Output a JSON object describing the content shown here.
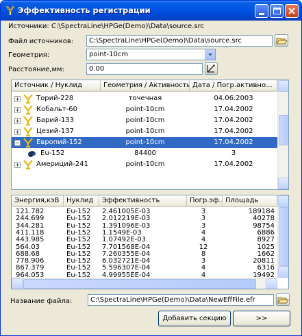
{
  "window": {
    "title": "Эффективность регистрации"
  },
  "sources_label": "Источники: C:\\SpectraLine\\HPGe(Demo)\\Data\\source.src",
  "form": {
    "file_label": "Файл источников:",
    "file_value": "C:\\SpectraLine\\HPGe(Demo)\\Data\\source.src",
    "geometry_label": "Геометрия:",
    "geometry_value": "point-10cm",
    "distance_label": "Расстояние,мм:",
    "distance_value": "0.00"
  },
  "tree": {
    "headers": [
      "Источник / Нуклид",
      "Геометрия / Активность",
      "Дата / Погр.активно..."
    ],
    "rows": [
      {
        "name": "Торий-228",
        "col2": "точечная",
        "col3": "04.06.2003",
        "expander": "+"
      },
      {
        "name": "Кобальт-60",
        "col2": "point-10cm",
        "col3": "17.04.2002",
        "expander": "+"
      },
      {
        "name": "Барий-133",
        "col2": "point-10cm",
        "col3": "17.04.2002",
        "expander": "+"
      },
      {
        "name": "Цезий-137",
        "col2": "point-10cm",
        "col3": "17.04.2002",
        "expander": "+"
      },
      {
        "name": "Европий-152",
        "col2": "point-10cm",
        "col3": "17.04.2002",
        "expander": "−"
      },
      {
        "name": "Eu-152",
        "col2": "84400",
        "col3": "3",
        "expander": ""
      },
      {
        "name": "Америций-241",
        "col2": "point-10cm",
        "col3": "17.04.2002",
        "expander": "+"
      }
    ]
  },
  "eff_table": {
    "headers": [
      "Энергия,кэВ",
      "Нуклид",
      "Эффективность",
      "Погр.эф...",
      "Площадь"
    ],
    "rows": [
      [
        "121.782",
        "Eu-152",
        "2.461005E-03",
        "3",
        "189184"
      ],
      [
        "244.699",
        "Eu-152",
        "2.012219E-03",
        "3",
        "40278"
      ],
      [
        "344.281",
        "Eu-152",
        "1.391096E-03",
        "3",
        "98754"
      ],
      [
        "411.118",
        "Eu-152",
        "1.1549E-03",
        "4",
        "6886"
      ],
      [
        "443.985",
        "Eu-152",
        "1.07492E-03",
        "4",
        "8927"
      ],
      [
        "564.03",
        "Eu-152",
        "7.701568E-04",
        "12",
        "1025"
      ],
      [
        "688.68",
        "Eu-152",
        "7.260355E-04",
        "8",
        "1662"
      ],
      [
        "778.906",
        "Eu-152",
        "6.032721E-04",
        "3",
        "20811"
      ],
      [
        "867.379",
        "Eu-152",
        "5.596307E-04",
        "4",
        "6316"
      ],
      [
        "964.053",
        "Eu-152",
        "4.99955EE-04",
        "4",
        "19492"
      ]
    ]
  },
  "output": {
    "label": "Название файла:",
    "value": "C:\\SpectraLine\\HPGe(Demo)\\Data\\NewEffFile.efr"
  },
  "buttons": {
    "add_section": "Добавить секцию",
    "next": ">>"
  },
  "colors": {
    "selection": "#316ac5",
    "titlebar": "#0054e3"
  }
}
